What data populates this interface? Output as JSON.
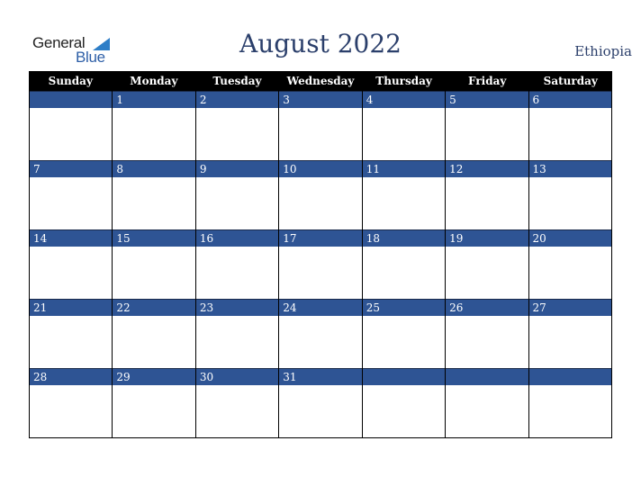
{
  "logo": {
    "general": "General",
    "blue": "Blue"
  },
  "header": {
    "title": "August 2022",
    "country": "Ethiopia"
  },
  "weekdays": [
    "Sunday",
    "Monday",
    "Tuesday",
    "Wednesday",
    "Thursday",
    "Friday",
    "Saturday"
  ],
  "weeks": [
    [
      "",
      "1",
      "2",
      "3",
      "4",
      "5",
      "6"
    ],
    [
      "7",
      "8",
      "9",
      "10",
      "11",
      "12",
      "13"
    ],
    [
      "14",
      "15",
      "16",
      "17",
      "18",
      "19",
      "20"
    ],
    [
      "21",
      "22",
      "23",
      "24",
      "25",
      "26",
      "27"
    ],
    [
      "28",
      "29",
      "30",
      "31",
      "",
      "",
      ""
    ]
  ],
  "colors": {
    "band": "#2e5494",
    "header": "#000000",
    "title": "#2b3f6b"
  }
}
